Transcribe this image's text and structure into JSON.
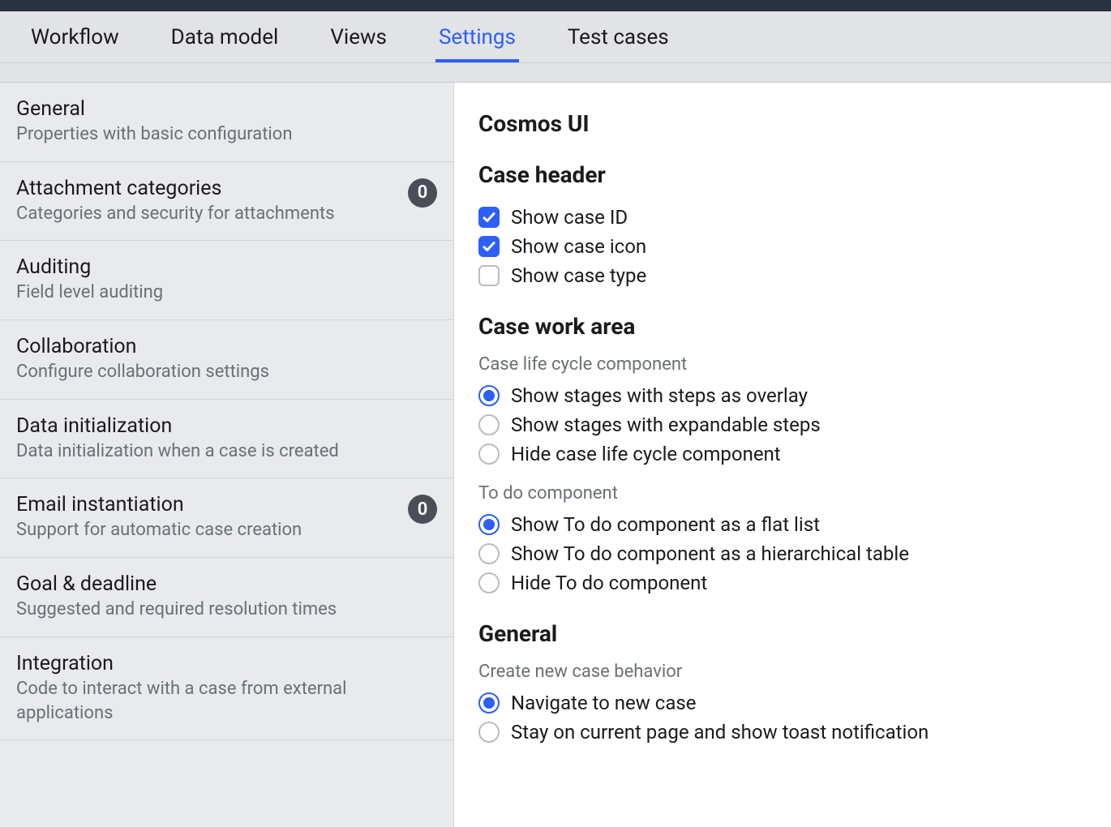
{
  "tabs": [
    {
      "label": "Workflow"
    },
    {
      "label": "Data model"
    },
    {
      "label": "Views"
    },
    {
      "label": "Settings"
    },
    {
      "label": "Test cases"
    }
  ],
  "active_tab_index": 3,
  "sidebar": [
    {
      "title": "General",
      "desc": "Properties with basic configuration"
    },
    {
      "title": "Attachment categories",
      "desc": "Categories and security for attachments",
      "badge": "0"
    },
    {
      "title": "Auditing",
      "desc": "Field level auditing"
    },
    {
      "title": "Collaboration",
      "desc": "Configure collaboration settings"
    },
    {
      "title": "Data initialization",
      "desc": "Data initialization when a case is created"
    },
    {
      "title": "Email instantiation",
      "desc": "Support for automatic case creation",
      "badge": "0"
    },
    {
      "title": "Goal & deadline",
      "desc": "Suggested and required resolution times"
    },
    {
      "title": "Integration",
      "desc": "Code to interact with a case from external applications"
    }
  ],
  "content": {
    "title": "Cosmos UI",
    "case_header": {
      "heading": "Case header",
      "show_case_id": {
        "label": "Show case ID",
        "checked": true
      },
      "show_case_icon": {
        "label": "Show case icon",
        "checked": true
      },
      "show_case_type": {
        "label": "Show case type",
        "checked": false
      }
    },
    "case_work_area": {
      "heading": "Case work area",
      "lifecycle": {
        "label": "Case life cycle component",
        "options": [
          "Show stages with steps as overlay",
          "Show stages with expandable steps",
          "Hide case life cycle component"
        ],
        "selected_index": 0
      },
      "todo": {
        "label": "To do component",
        "options": [
          "Show To do component as a flat list",
          "Show To do component as a hierarchical table",
          "Hide To do component"
        ],
        "selected_index": 0
      }
    },
    "general": {
      "heading": "General",
      "create_behavior": {
        "label": "Create new case behavior",
        "options": [
          "Navigate to new case",
          "Stay on current page and show toast notification"
        ],
        "selected_index": 0
      }
    }
  }
}
